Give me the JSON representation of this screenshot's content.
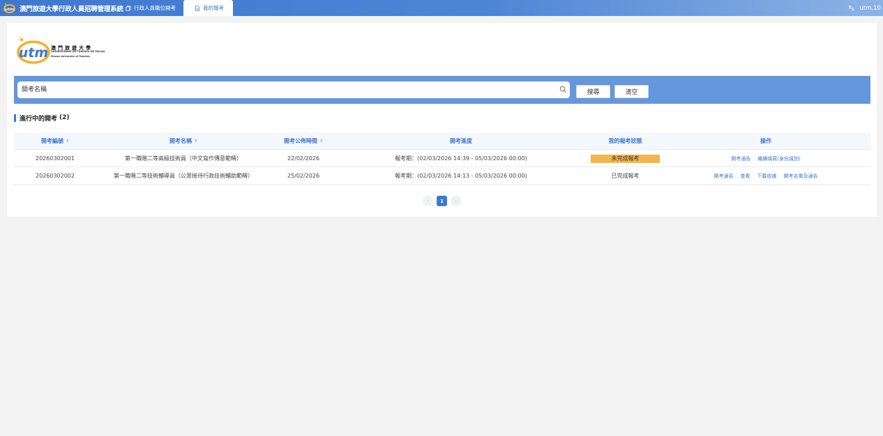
{
  "app": {
    "title": "澳門旅遊大學行政人員招聘管理系統"
  },
  "tabs": [
    {
      "label": "行政人員職位開考",
      "icon": "copy-icon"
    },
    {
      "label": "我的報考",
      "icon": "document-icon",
      "active": true
    }
  ],
  "user": {
    "name": "utm,10",
    "icon": "translate-icon"
  },
  "university": {
    "name_zh": "澳門旅遊大學",
    "name_pt": "UNIVERSIDADE DE TURISMO DE MACAU",
    "name_en": "Macao University of Tourism",
    "logo_text": "utm"
  },
  "search": {
    "placeholder": "開考名稱",
    "search_label": "搜尋",
    "clear_label": "清空"
  },
  "section": {
    "title": "進行中的開考",
    "count": "(2)"
  },
  "table": {
    "headers": [
      "開考編號",
      "開考名稱",
      "開考公佈時間",
      "開考進度",
      "我的報考狀態",
      "操作"
    ],
    "rows": [
      {
        "id": "20260302001",
        "name": "第一職階二等高級技術員（中文寫作傳意範疇）",
        "date": "22/02/2026",
        "progress": "報考期：(02/03/2026 14:39 - 05/03/2026 00:00)",
        "status": "未完成報考",
        "actions": [
          "開考通告",
          "繼續填寫(身份識別)"
        ]
      },
      {
        "id": "20260302002",
        "name": "第一職階二等技術輔導員（公眾接待行政技術輔助範疇）",
        "date": "25/02/2026",
        "progress": "報考期：(02/03/2026 14:13 - 05/03/2026 00:00)",
        "status": "已完成報考",
        "actions": [
          "開考通告",
          "查看",
          "下載收據",
          "開考名單及通告"
        ]
      }
    ]
  },
  "pagination": {
    "prev": "‹",
    "current": "1",
    "next": "›"
  },
  "colors": {
    "primary": "#3f78cf",
    "searchbar": "#6597dc",
    "pending": "#f5b54a"
  }
}
